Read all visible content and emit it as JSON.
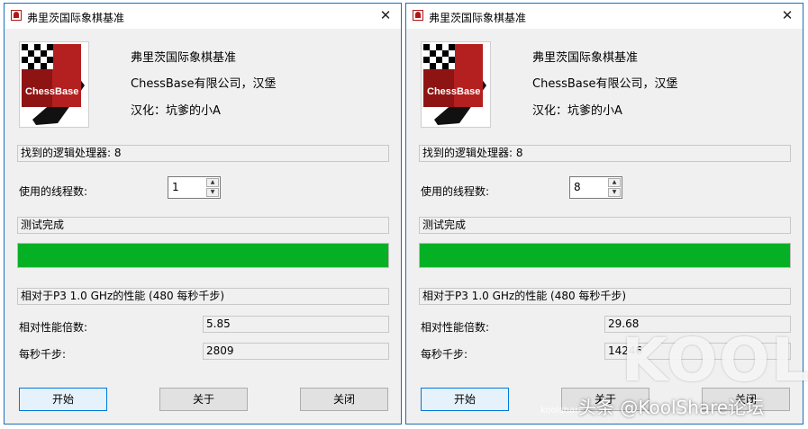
{
  "colors": {
    "progress_fill": "#06b025",
    "window_border": "#1c6fb9",
    "logo_red": "#b01818"
  },
  "icons": {
    "title_icon": "chessbase-app-icon",
    "close": "close-icon",
    "logo": "chessbase-logo-icon"
  },
  "left": {
    "title": "弗里茨国际象棋基准",
    "close": "✕",
    "logo_text": "ChessBase",
    "info": [
      "弗里茨国际象棋基准",
      "ChessBase有限公司，汉堡",
      "汉化：坑爹的小A"
    ],
    "processors": "找到的逻辑处理器: 8",
    "threads_label": "使用的线程数:",
    "threads_value": "1",
    "status": "测试完成",
    "progress": 1.0,
    "perf_header": "相对于P3 1.0 GHz的性能 (480 每秒千步)",
    "rel_label": "相对性能倍数:",
    "rel_value": "5.85",
    "kns_label": "每秒千步:",
    "kns_value": "2809",
    "buttons": {
      "start": "开始",
      "about": "关于",
      "close": "关闭"
    }
  },
  "right": {
    "title": "弗里茨国际象棋基准",
    "close": "✕",
    "logo_text": "ChessBase",
    "info": [
      "弗里茨国际象棋基准",
      "ChessBase有限公司，汉堡",
      "汉化：坑爹的小A"
    ],
    "processors": "找到的逻辑处理器: 8",
    "threads_label": "使用的线程数:",
    "threads_value": "8",
    "status": "测试完成",
    "progress": 1.0,
    "perf_header": "相对于P3 1.0 GHz的性能 (480 每秒千步)",
    "rel_label": "相对性能倍数:",
    "rel_value": "29.68",
    "kns_label": "每秒千步:",
    "kns_value": "14246",
    "buttons": {
      "start": "开始",
      "about": "关于",
      "close": "关闭"
    }
  },
  "watermark": {
    "brand": "KOOL",
    "caption": "头条 @KoolShare论坛",
    "small": "koolshare"
  }
}
